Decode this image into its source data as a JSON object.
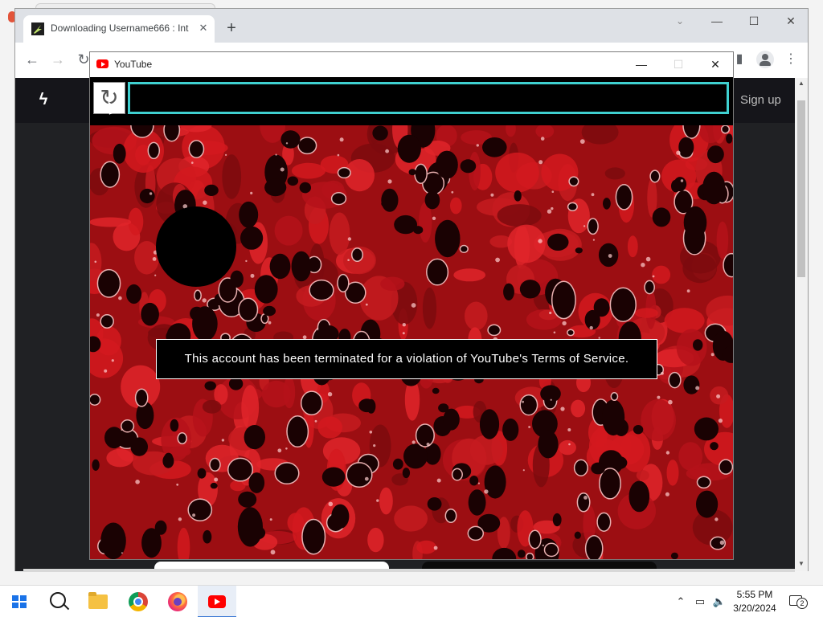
{
  "browser": {
    "tab_title": "Downloading Username666 : Int",
    "tab_close_icon": "close-icon",
    "new_tab_icon": "plus-icon",
    "window_controls": [
      "minimize",
      "maximize",
      "close"
    ]
  },
  "site": {
    "logo_icon": "lightning-logo-icon",
    "signup_label": "Sign up"
  },
  "popup": {
    "title": "YouTube",
    "reload_icon": "reload-icon",
    "message": "This account has been terminated for a violation of YouTube's Terms of Service.",
    "accent_color": "#3fd0d0",
    "background_color": "#c0121a"
  },
  "taskbar": {
    "apps": [
      "start-button",
      "search-button",
      "file-explorer",
      "chrome",
      "firefox",
      "youtube"
    ],
    "active_app": "youtube",
    "time": "5:55 PM",
    "date": "3/20/2024",
    "notification_count": "2"
  }
}
